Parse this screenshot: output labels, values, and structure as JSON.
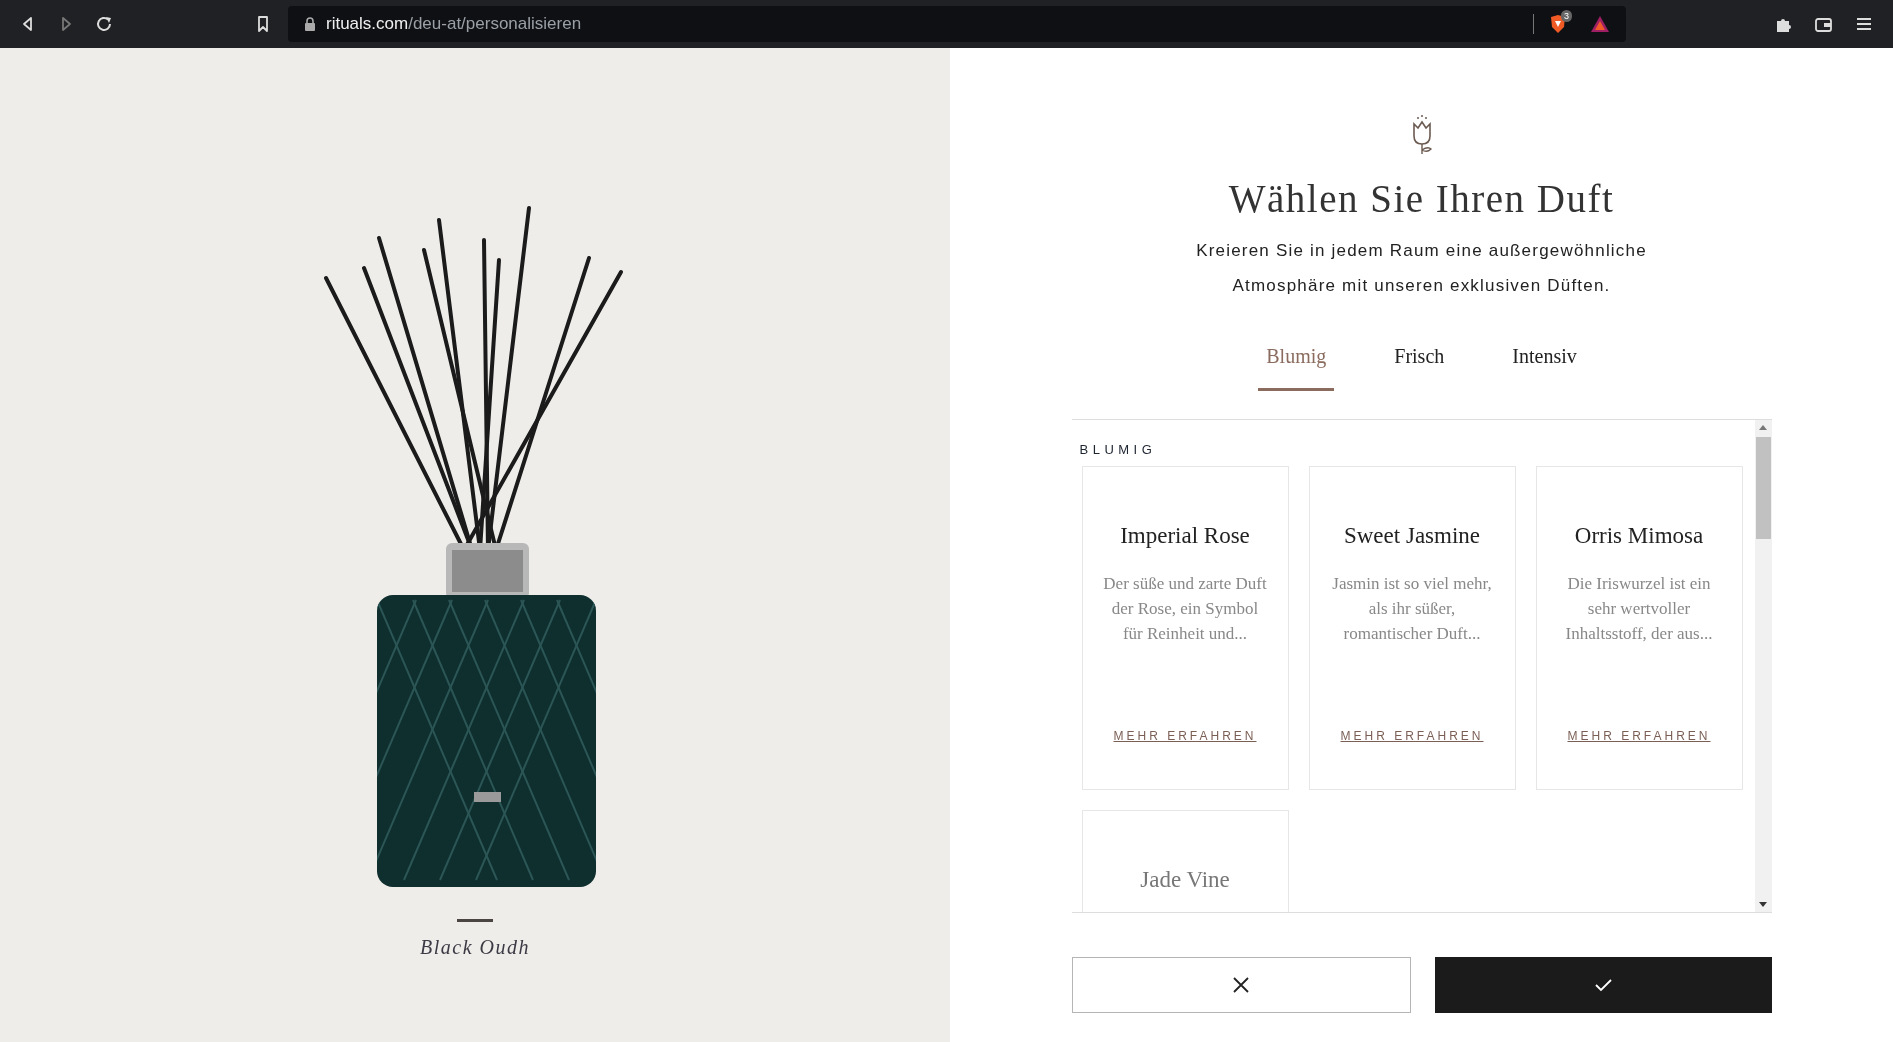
{
  "browser": {
    "url": {
      "host": "rituals.com",
      "path": "/deu-at/personalisieren"
    },
    "shield_badge": "3",
    "forward_disabled": true
  },
  "product": {
    "name": "Black Oudh"
  },
  "header": {
    "title": "Wählen Sie Ihren Duft",
    "subtitle": "Kreieren Sie in jedem Raum eine außergewöhnliche Atmosphäre mit unseren exklusiven Düften."
  },
  "tabs": [
    {
      "label": "Blumig",
      "selected": true
    },
    {
      "label": "Frisch",
      "selected": false
    },
    {
      "label": "Intensiv",
      "selected": false
    }
  ],
  "section": {
    "heading": "BLUMIG",
    "cards": [
      {
        "name": "Imperial Rose",
        "description": "Der süße und zarte Duft der Rose, ein Symbol für Reinheit und...",
        "link": "MEHR ERFAHREN"
      },
      {
        "name": "Sweet Jasmine",
        "description": "Jasmin ist so viel mehr, als ihr süßer, romantischer Duft...",
        "link": "MEHR ERFAHREN"
      },
      {
        "name": "Orris Mimosa",
        "description": "Die Iriswurzel ist ein sehr wertvoller Inhaltsstoff, der aus...",
        "link": "MEHR ERFAHREN"
      },
      {
        "name": "Jade Vine"
      }
    ]
  },
  "actions": [
    {
      "kind": "cancel"
    },
    {
      "kind": "confirm"
    }
  ]
}
